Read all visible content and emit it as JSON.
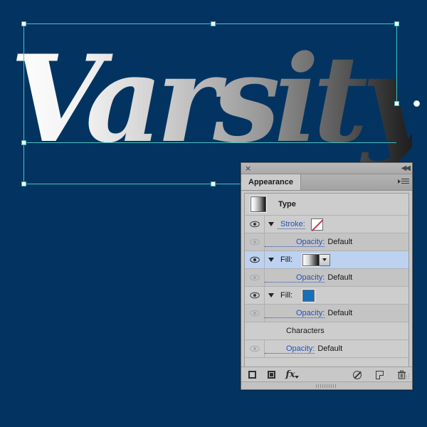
{
  "canvas": {
    "background_color": "#033461",
    "artwork_text": "Varsity",
    "gradient_start": "#ffffff",
    "gradient_end": "#0b0b0b",
    "selection_color": "#45c2c2"
  },
  "panel": {
    "titlebar": {
      "close_icon": "×",
      "collapse_icon": "◀◀"
    },
    "tab_label": "Appearance",
    "menu_icon": "panel-menu-icon",
    "type_row": {
      "label": "Type",
      "thumbnail": "gradient-type-thumbnail"
    },
    "rows": [
      {
        "kind": "attribute",
        "eye": "visible",
        "disclosure": "expanded",
        "label": "Stroke:",
        "swatch": "none",
        "swatch_color": "#ffffff"
      },
      {
        "kind": "opacity",
        "eye": "dim",
        "label": "Opacity:",
        "value": "Default"
      },
      {
        "kind": "attribute",
        "eye": "visible",
        "disclosure": "expanded",
        "label": "Fill:",
        "swatch": "gradient",
        "swatch_color": "#ffffff → #111111",
        "selected": true
      },
      {
        "kind": "opacity",
        "eye": "dim",
        "label": "Opacity:",
        "value": "Default"
      },
      {
        "kind": "attribute",
        "eye": "visible",
        "disclosure": "expanded",
        "label": "Fill:",
        "swatch": "solid",
        "swatch_color": "#1970b8"
      },
      {
        "kind": "opacity",
        "eye": "dim",
        "label": "Opacity:",
        "value": "Default"
      },
      {
        "kind": "group",
        "label": "Characters"
      },
      {
        "kind": "opacity",
        "eye": "dim",
        "label": "Opacity:",
        "value": "Default"
      }
    ],
    "footer": {
      "add_new_stroke": "add-new-stroke-icon",
      "add_new_fill": "add-new-fill-icon",
      "add_effect": "fx",
      "clear_appearance": "clear-appearance-icon",
      "duplicate_item": "duplicate-item-icon",
      "delete_item": "delete-item-icon"
    }
  }
}
